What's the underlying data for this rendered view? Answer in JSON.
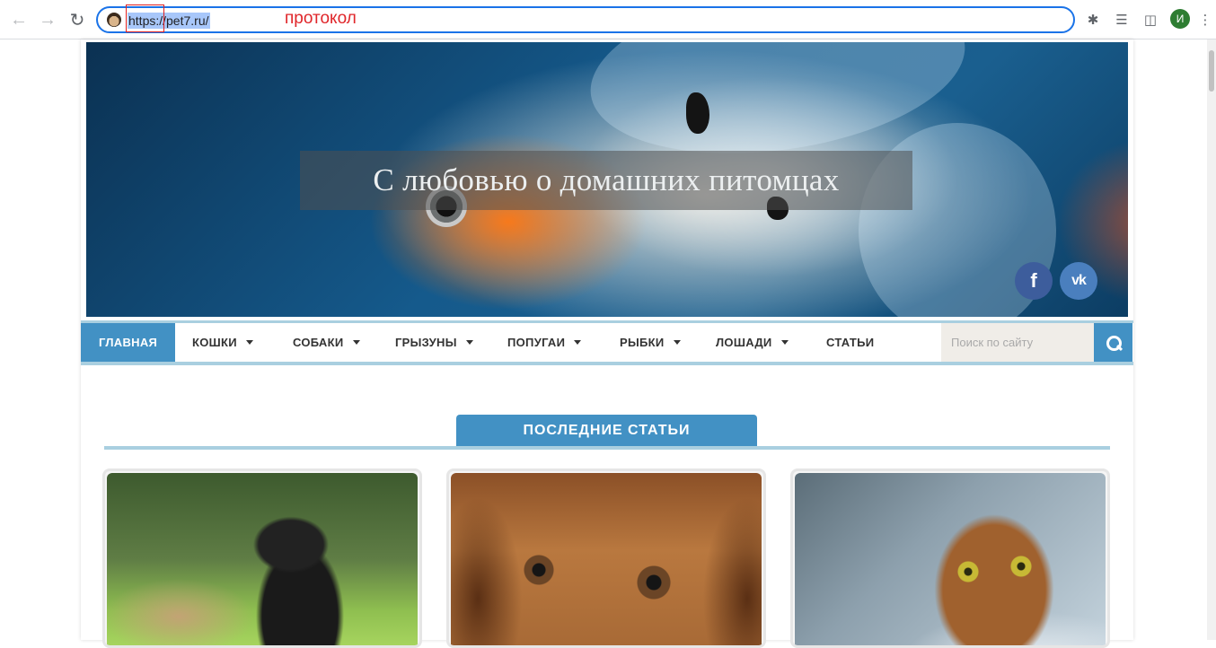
{
  "browser": {
    "url": "https://pet7.ru/",
    "annotation": "протокол",
    "avatar_letter": "И",
    "omnibox_border_color": "#1a73e8"
  },
  "site": {
    "hero_title": "С любовью о домашних питомцах",
    "social": {
      "facebook": "f",
      "vk": "vk"
    },
    "menu": [
      {
        "label": "ГЛАВНАЯ",
        "active": true,
        "dropdown": false
      },
      {
        "label": "КОШКИ",
        "active": false,
        "dropdown": true
      },
      {
        "label": "СОБАКИ",
        "active": false,
        "dropdown": true
      },
      {
        "label": "ГРЫЗУНЫ",
        "active": false,
        "dropdown": true
      },
      {
        "label": "ПОПУГАИ",
        "active": false,
        "dropdown": true
      },
      {
        "label": "РЫБКИ",
        "active": false,
        "dropdown": true
      },
      {
        "label": "ЛОШАДИ",
        "active": false,
        "dropdown": true
      },
      {
        "label": "СТАТЬИ",
        "active": false,
        "dropdown": false
      }
    ],
    "search_placeholder": "Поиск по сайту",
    "section_title": "ПОСЛЕДНИЕ СТАТЬИ",
    "accent_color": "#4291c4",
    "cards": [
      {
        "image": "dog-giving-paw-photo"
      },
      {
        "image": "beagle-face-photo"
      },
      {
        "image": "abyssinian-cat-photo"
      }
    ]
  }
}
